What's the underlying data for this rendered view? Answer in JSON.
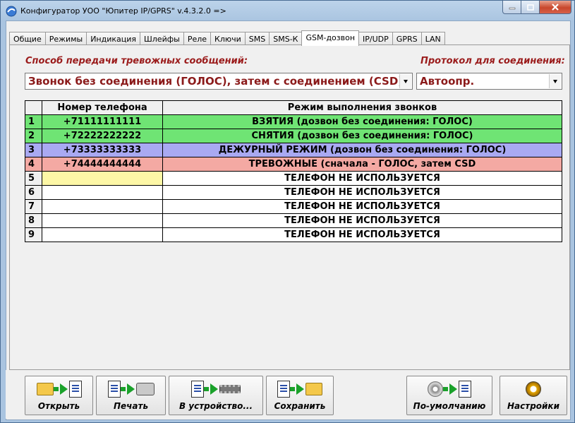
{
  "window": {
    "title": "Конфигуратор УОО \"Юпитер IP/GPRS\" v.4.3.2.0  =>"
  },
  "tabs": [
    {
      "label": "Общие",
      "active": false
    },
    {
      "label": "Режимы",
      "active": false
    },
    {
      "label": "Индикация",
      "active": false
    },
    {
      "label": "Шлейфы",
      "active": false
    },
    {
      "label": "Реле",
      "active": false
    },
    {
      "label": "Ключи",
      "active": false
    },
    {
      "label": "SMS",
      "active": false
    },
    {
      "label": "SMS-К",
      "active": false
    },
    {
      "label": "GSM-дозвон",
      "active": true
    },
    {
      "label": "IP/UDP",
      "active": false
    },
    {
      "label": "GPRS",
      "active": false
    },
    {
      "label": "LAN",
      "active": false
    }
  ],
  "alarm_method": {
    "label": "Способ передачи тревожных сообщений:",
    "value": "Звонок без соединения (ГОЛОС), затем с соединением (CSD)"
  },
  "protocol": {
    "label": "Протокол для соединения:",
    "value": "Автоопр."
  },
  "table": {
    "headers": [
      "Номер телефона",
      "Режим выполнения звонков"
    ],
    "rows": [
      {
        "n": "1",
        "phone": "+71111111111",
        "mode": "ВЗЯТИЯ (дозвон без соединения: ГОЛОС)",
        "color": "#6fe474"
      },
      {
        "n": "2",
        "phone": "+72222222222",
        "mode": "СНЯТИЯ (дозвон без соединения: ГОЛОС)",
        "color": "#6fe474"
      },
      {
        "n": "3",
        "phone": "+73333333333",
        "mode": "ДЕЖУРНЫЙ РЕЖИМ (дозвон без соединения: ГОЛОС)",
        "color": "#a9a9f2"
      },
      {
        "n": "4",
        "phone": "+74444444444",
        "mode": "ТРЕВОЖНЫЕ (сначала - ГОЛОС, затем CSD",
        "color": "#f4a9a3"
      },
      {
        "n": "5",
        "phone": "",
        "mode": "ТЕЛЕФОН НЕ ИСПОЛЬЗУЕТСЯ",
        "color": "#ffffff"
      },
      {
        "n": "6",
        "phone": "",
        "mode": "ТЕЛЕФОН НЕ ИСПОЛЬЗУЕТСЯ",
        "color": "#ffffff"
      },
      {
        "n": "7",
        "phone": "",
        "mode": "ТЕЛЕФОН НЕ ИСПОЛЬЗУЕТСЯ",
        "color": "#ffffff"
      },
      {
        "n": "8",
        "phone": "",
        "mode": "ТЕЛЕФОН НЕ ИСПОЛЬЗУЕТСЯ",
        "color": "#ffffff"
      },
      {
        "n": "9",
        "phone": "",
        "mode": "ТЕЛЕФОН НЕ ИСПОЛЬЗУЕТСЯ",
        "color": "#ffffff"
      }
    ]
  },
  "toolbar": {
    "open": "Открыть",
    "print": "Печать",
    "to_device": "В устройство...",
    "save": "Сохранить",
    "defaults": "По-умолчанию",
    "settings": "Настройки"
  },
  "icons": {
    "app": "app-globe-icon",
    "minimize": "minimize-icon",
    "maximize": "maximize-icon",
    "close": "close-icon",
    "dropdown": "chevron-down-icon"
  }
}
